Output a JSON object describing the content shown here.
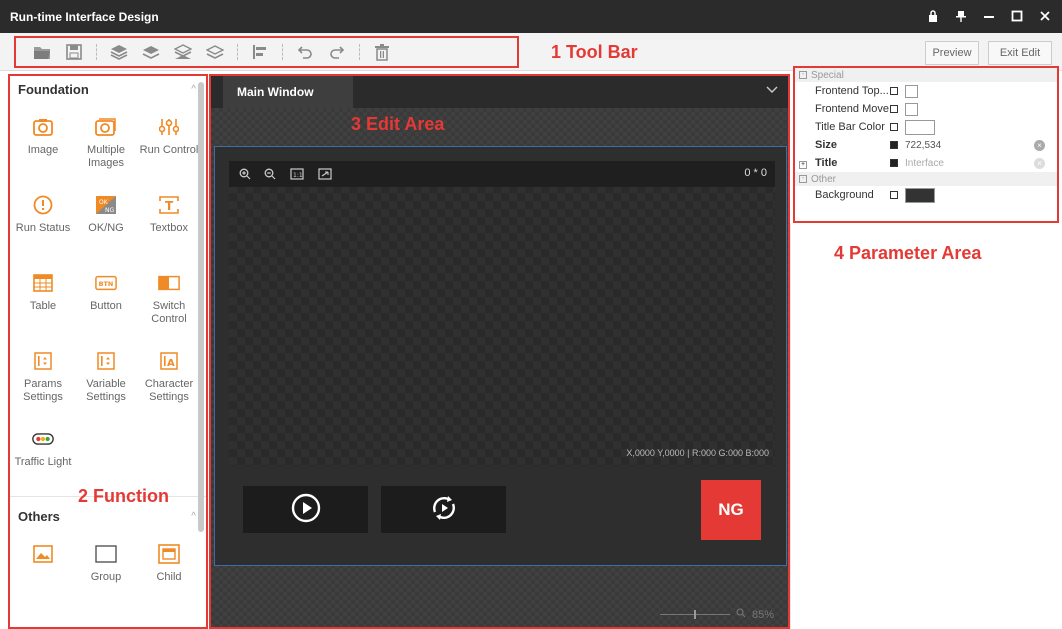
{
  "window": {
    "title": "Run-time Interface Design",
    "controls": [
      "lock-icon",
      "pin-icon",
      "minimize-icon",
      "maximize-icon",
      "close-icon"
    ]
  },
  "toolbar": {
    "annotation": "1 Tool Bar",
    "icons": [
      "open-folder-icon",
      "save-icon",
      "layer-top-icon",
      "layer-up-icon",
      "layer-down-icon",
      "layer-bottom-icon",
      "align-icon",
      "undo-icon",
      "redo-icon",
      "delete-icon"
    ],
    "preview_label": "Preview",
    "exit_edit_label": "Exit Edit"
  },
  "function_panel": {
    "annotation": "2 Function",
    "foundation": {
      "title": "Foundation",
      "items": [
        {
          "label": "Image",
          "icon": "camera-icon"
        },
        {
          "label": "Multiple Images",
          "icon": "multi-camera-icon"
        },
        {
          "label": "Run Control",
          "icon": "run-control-icon"
        },
        {
          "label": "Run Status",
          "icon": "run-status-icon"
        },
        {
          "label": "OK/NG",
          "icon": "ok-ng-icon"
        },
        {
          "label": "Textbox",
          "icon": "textbox-icon"
        },
        {
          "label": "Table",
          "icon": "table-icon"
        },
        {
          "label": "Button",
          "icon": "button-icon"
        },
        {
          "label": "Switch Control",
          "icon": "switch-icon"
        },
        {
          "label": "Params Settings",
          "icon": "params-icon"
        },
        {
          "label": "Variable Settings",
          "icon": "variable-icon"
        },
        {
          "label": "Character Settings",
          "icon": "character-icon"
        },
        {
          "label": "Traffic Light",
          "icon": "traffic-light-icon"
        }
      ]
    },
    "others": {
      "title": "Others",
      "items": [
        {
          "label": "",
          "icon": "picture-icon"
        },
        {
          "label": "Group",
          "icon": "group-icon"
        },
        {
          "label": "Child",
          "icon": "child-window-icon"
        }
      ]
    }
  },
  "edit_area": {
    "annotation": "3 Edit Area",
    "tab_label": "Main Window",
    "coords": "0 * 0",
    "status": "X,0000  Y,0000  |  R:000  G:000  B:000",
    "ng_label": "NG",
    "zoom": "85%"
  },
  "param_area": {
    "annotation": "4 Parameter Area",
    "groups": [
      {
        "name": "Special",
        "rows": [
          {
            "name": "Frontend Top...",
            "value": ""
          },
          {
            "name": "Frontend Move",
            "value": ""
          },
          {
            "name": "Title Bar Color",
            "value": ""
          },
          {
            "name": "Size",
            "value": "722,534"
          },
          {
            "name": "Title",
            "value": "Interface"
          }
        ]
      },
      {
        "name": "Other",
        "rows": [
          {
            "name": "Background",
            "value": ""
          }
        ]
      }
    ]
  },
  "colors": {
    "accent": "#e53935",
    "dark_bg": "#2b2b2b",
    "icon_orange": "#f08a24"
  }
}
